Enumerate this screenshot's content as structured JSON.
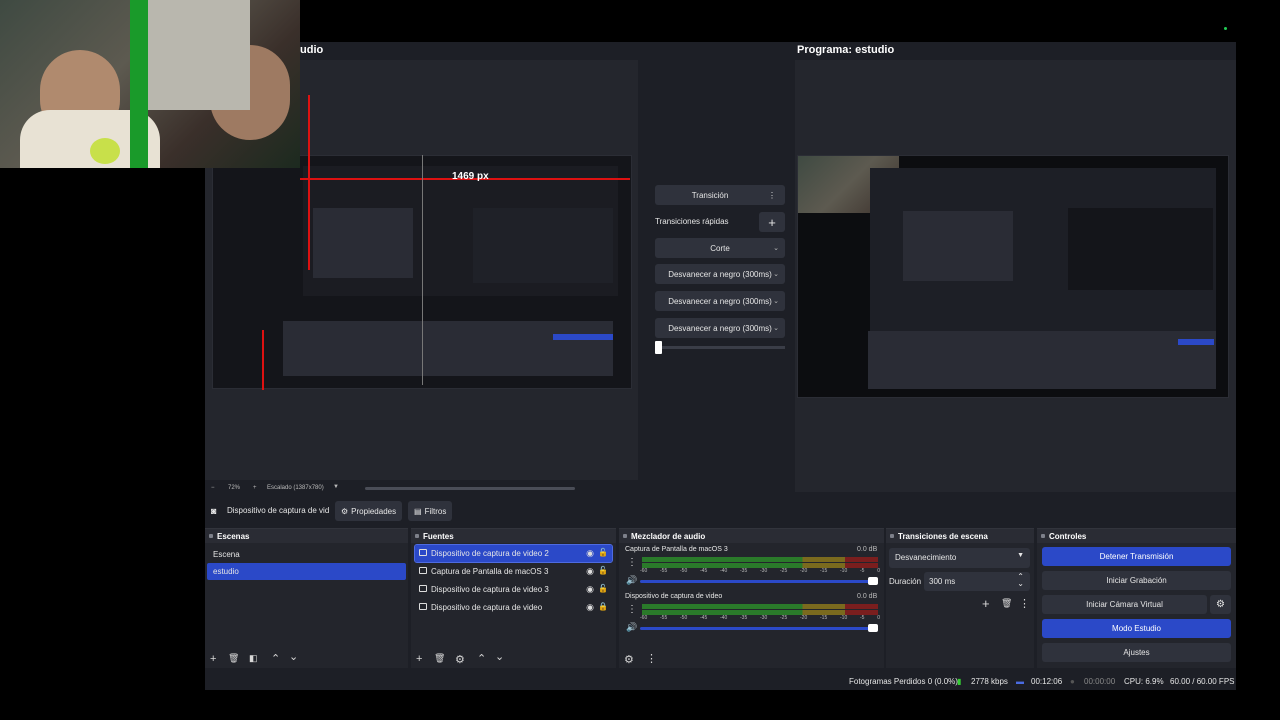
{
  "preview": {
    "title_fragment": "udio",
    "dimension_label": "1469 px",
    "zoom": "72%",
    "scale_label": "Escalado (1387x780)"
  },
  "program": {
    "title": "Programa: estudio"
  },
  "transitions_panel": {
    "transition_button": "Transición",
    "quick_transitions_label": "Transiciones rápidas",
    "items": [
      "Corte",
      "Desvanecer a negro (300ms)",
      "Desvanecer a negro (300ms)",
      "Desvanecer a negro (300ms)"
    ]
  },
  "properties_bar": {
    "source_name": "Dispositivo de captura de vid",
    "properties_button": "Propiedades",
    "filters_button": "Filtros"
  },
  "scenes": {
    "title": "Escenas",
    "items": [
      {
        "label": "Escena",
        "selected": false
      },
      {
        "label": "estudio",
        "selected": true
      }
    ]
  },
  "sources": {
    "title": "Fuentes",
    "items": [
      {
        "label": "Dispositivo de captura de video 2",
        "selected": true,
        "icon": "camera-icon"
      },
      {
        "label": "Captura de Pantalla de macOS 3",
        "selected": false,
        "icon": "monitor-icon"
      },
      {
        "label": "Dispositivo de captura de video 3",
        "selected": false,
        "icon": "camera-icon"
      },
      {
        "label": "Dispositivo de captura de video",
        "selected": false,
        "icon": "camera-icon"
      }
    ]
  },
  "mixer": {
    "title": "Mezclador de audio",
    "channels": [
      {
        "name": "Captura de Pantalla de macOS 3",
        "db": "0.0 dB",
        "volume": 1.0
      },
      {
        "name": "Dispositivo de captura de video",
        "db": "0.0 dB",
        "volume": 1.0
      }
    ],
    "scale": [
      "-60",
      "-55",
      "-50",
      "-45",
      "-40",
      "-35",
      "-30",
      "-25",
      "-20",
      "-15",
      "-10",
      "-5",
      "0"
    ]
  },
  "scene_transitions": {
    "title": "Transiciones de escena",
    "selected": "Desvanecimiento",
    "duration_label": "Duración",
    "duration_value": "300 ms"
  },
  "controls": {
    "title": "Controles",
    "buttons": [
      {
        "label": "Detener Transmisión",
        "active": true
      },
      {
        "label": "Iniciar Grabación",
        "active": false
      },
      {
        "label": "Iniciar Cámara Virtual",
        "active": false
      },
      {
        "label": "Modo Estudio",
        "active": true
      },
      {
        "label": "Ajustes",
        "active": false
      }
    ]
  },
  "status": {
    "dropped_frames": "Fotogramas Perdidos 0 (0.0%)",
    "bitrate": "2778 kbps",
    "stream_time": "00:12:06",
    "record_time": "00:00:00",
    "cpu": "CPU: 6.9%",
    "fps": "60.00 / 60.00 FPS"
  },
  "colors": {
    "accent": "#2b49c8",
    "panel": "#23252c",
    "background": "#1d1f26"
  }
}
